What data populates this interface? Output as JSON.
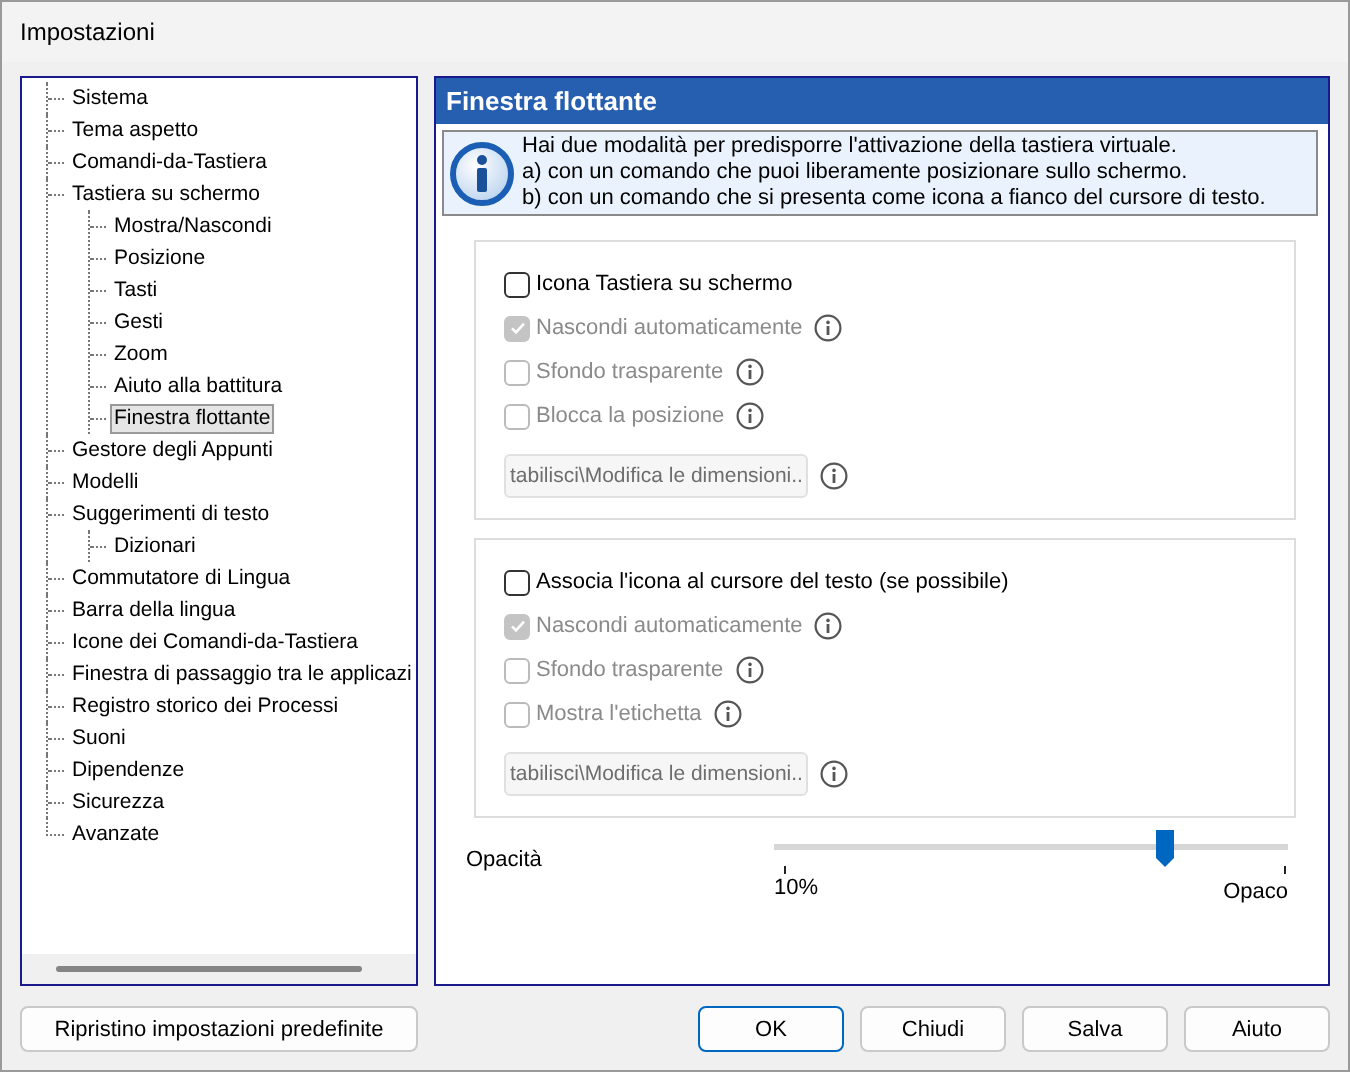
{
  "window": {
    "title": "Impostazioni"
  },
  "tree": [
    {
      "label": "Sistema",
      "selected": false
    },
    {
      "label": "Tema aspetto",
      "selected": false
    },
    {
      "label": "Comandi-da-Tastiera",
      "selected": false
    },
    {
      "label": "Tastiera su schermo",
      "selected": false,
      "children": [
        {
          "label": "Mostra/Nascondi",
          "selected": false
        },
        {
          "label": "Posizione",
          "selected": false
        },
        {
          "label": "Tasti",
          "selected": false
        },
        {
          "label": "Gesti",
          "selected": false
        },
        {
          "label": "Zoom",
          "selected": false
        },
        {
          "label": "Aiuto alla battitura",
          "selected": false
        },
        {
          "label": "Finestra flottante",
          "selected": true
        }
      ]
    },
    {
      "label": "Gestore degli Appunti",
      "selected": false
    },
    {
      "label": "Modelli",
      "selected": false
    },
    {
      "label": "Suggerimenti di testo",
      "selected": false,
      "children": [
        {
          "label": "Dizionari",
          "selected": false
        }
      ]
    },
    {
      "label": "Commutatore di Lingua",
      "selected": false
    },
    {
      "label": "Barra della lingua",
      "selected": false
    },
    {
      "label": "Icone dei Comandi-da-Tastiera",
      "selected": false
    },
    {
      "label": "Finestra di passaggio tra le applicazi",
      "selected": false
    },
    {
      "label": "Registro storico dei Processi",
      "selected": false
    },
    {
      "label": "Suoni",
      "selected": false
    },
    {
      "label": "Dipendenze",
      "selected": false
    },
    {
      "label": "Sicurezza",
      "selected": false
    },
    {
      "label": "Avanzate",
      "selected": false
    }
  ],
  "reset_button": "Ripristino impostazioni predefinite",
  "panel": {
    "title": "Finestra flottante",
    "info": [
      "Hai due modalità per predisporre l'attivazione della tastiera virtuale.",
      "a) con un comando che puoi liberamente posizionare sullo schermo.",
      "b) con un comando che si presenta come icona a fianco del cursore di testo."
    ],
    "groups": [
      {
        "items": [
          {
            "kind": "checkbox",
            "label": "Icona Tastiera su schermo",
            "checked": false,
            "disabled": false,
            "info": false
          },
          {
            "kind": "checkbox",
            "label": "Nascondi automaticamente",
            "checked": true,
            "disabled": true,
            "info": true
          },
          {
            "kind": "checkbox",
            "label": "Sfondo trasparente",
            "checked": false,
            "disabled": true,
            "info": true
          },
          {
            "kind": "checkbox",
            "label": "Blocca la posizione",
            "checked": false,
            "disabled": true,
            "info": true
          },
          {
            "kind": "field",
            "value": "tabilisci\\Modifica le dimensioni..",
            "disabled": true,
            "info": true
          }
        ]
      },
      {
        "items": [
          {
            "kind": "checkbox",
            "label": "Associa l'icona al cursore del testo (se possibile)",
            "checked": false,
            "disabled": false,
            "info": false
          },
          {
            "kind": "checkbox",
            "label": "Nascondi automaticamente",
            "checked": true,
            "disabled": true,
            "info": true
          },
          {
            "kind": "checkbox",
            "label": "Sfondo trasparente",
            "checked": false,
            "disabled": true,
            "info": true
          },
          {
            "kind": "checkbox",
            "label": "Mostra l'etichetta",
            "checked": false,
            "disabled": true,
            "info": true
          },
          {
            "kind": "field",
            "value": "tabilisci\\Modifica le dimensioni..",
            "disabled": true,
            "info": true
          }
        ]
      }
    ],
    "opacity": {
      "label": "Opacità",
      "level": 0.76,
      "min_label": "10%",
      "max_label": "Opaco"
    }
  },
  "buttons": [
    {
      "label": "OK",
      "selected": true
    },
    {
      "label": "Chiudi",
      "selected": false
    },
    {
      "label": "Salva",
      "selected": false
    },
    {
      "label": "Aiuto",
      "selected": false
    }
  ]
}
